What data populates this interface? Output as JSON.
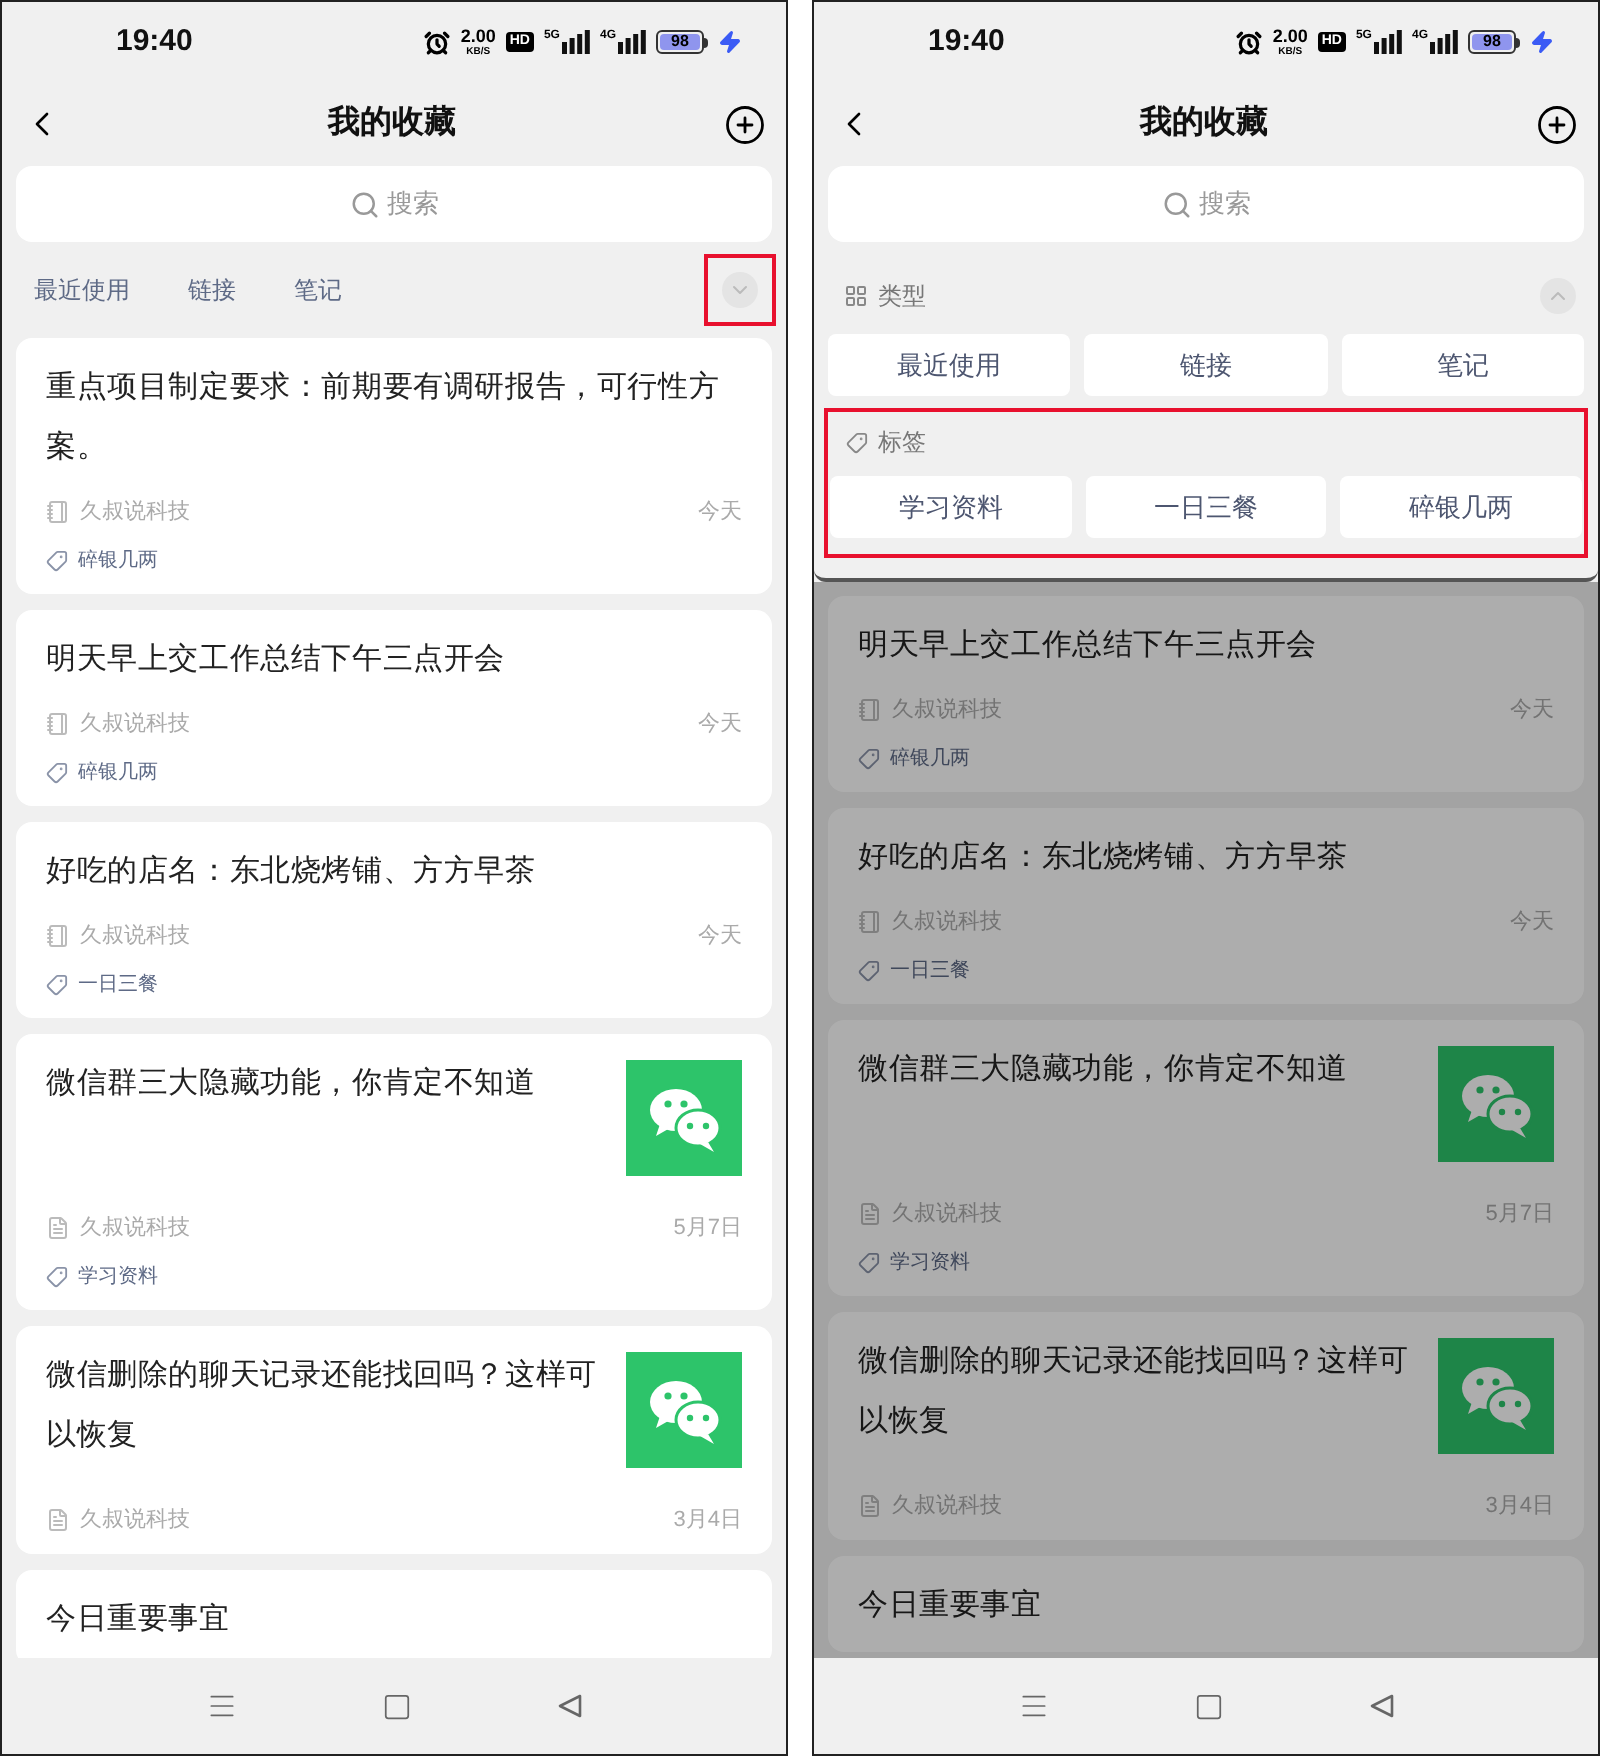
{
  "screens": [
    {
      "kind": "list",
      "status_bar": {
        "time": "19:40",
        "speed": "2.00",
        "speed_unit": "KB/S",
        "hd": "HD",
        "net_1": "5G",
        "net_2": "4G",
        "battery": "98"
      },
      "title": "我的收藏",
      "search": {
        "placeholder": "搜索"
      },
      "filter_tabs": [
        "最近使用",
        "链接",
        "笔记"
      ],
      "expand_highlighted": true,
      "cards": [
        {
          "title": "重点项目制定要求：前期要有调研报告，可行性方案。",
          "kind": "note",
          "source": "久叔说科技",
          "date": "今天",
          "tag": "碎银几两",
          "thumbnail": false
        },
        {
          "title": "明天早上交工作总结下午三点开会",
          "kind": "note",
          "source": "久叔说科技",
          "date": "今天",
          "tag": "碎银几两",
          "thumbnail": false
        },
        {
          "title": "好吃的店名：东北烧烤铺、方方早茶",
          "kind": "note",
          "source": "久叔说科技",
          "date": "今天",
          "tag": "一日三餐",
          "thumbnail": false
        },
        {
          "title": "微信群三大隐藏功能，你肯定不知道",
          "kind": "link",
          "source": "久叔说科技",
          "date": "5月7日",
          "tag": "学习资料",
          "thumbnail": true
        },
        {
          "title": "微信删除的聊天记录还能找回吗？这样可以恢复",
          "kind": "link",
          "source": "久叔说科技",
          "date": "3月4日",
          "thumbnail": true
        },
        {
          "title": "今日重要事宜",
          "thumbnail": false
        }
      ]
    },
    {
      "kind": "filter_open",
      "status_bar": {
        "time": "19:40",
        "speed": "2.00",
        "speed_unit": "KB/S",
        "hd": "HD",
        "net_1": "5G",
        "net_2": "4G",
        "battery": "98"
      },
      "title": "我的收藏",
      "search": {
        "placeholder": "搜索"
      },
      "panel": {
        "type_label": "类型",
        "types": [
          "最近使用",
          "链接",
          "笔记"
        ],
        "tag_label": "标签",
        "tags": [
          "学习资料",
          "一日三餐",
          "碎银几两"
        ],
        "tags_highlighted": true
      },
      "cards": [
        {
          "title": "明天早上交工作总结下午三点开会",
          "kind": "note",
          "source": "久叔说科技",
          "date": "今天",
          "tag": "碎银几两",
          "thumbnail": false
        },
        {
          "title": "好吃的店名：东北烧烤铺、方方早茶",
          "kind": "note",
          "source": "久叔说科技",
          "date": "今天",
          "tag": "一日三餐",
          "thumbnail": false
        },
        {
          "title": "微信群三大隐藏功能，你肯定不知道",
          "kind": "link",
          "source": "久叔说科技",
          "date": "5月7日",
          "tag": "学习资料",
          "thumbnail": true
        },
        {
          "title": "微信删除的聊天记录还能找回吗？这样可以恢复",
          "kind": "link",
          "source": "久叔说科技",
          "date": "3月4日",
          "thumbnail": true
        },
        {
          "title": "今日重要事宜",
          "thumbnail": false
        }
      ]
    }
  ]
}
